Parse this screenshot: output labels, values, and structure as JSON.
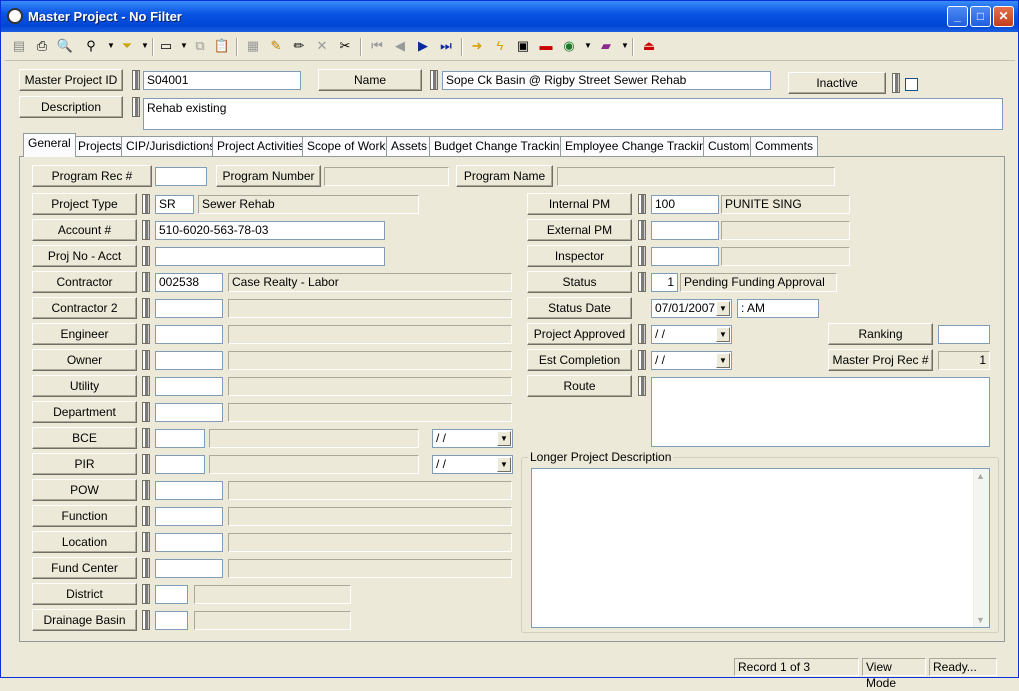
{
  "window": {
    "title": "Master Project - No Filter",
    "minimize": "_",
    "maximize": "□",
    "close": "✕"
  },
  "toolbar": {
    "icons": [
      "save-icon",
      "print-icon",
      "print-preview-icon",
      "binoculars-icon",
      "filter-icon",
      "new-record-icon",
      "copy-icon",
      "paste-icon",
      "undo-icon",
      "edit-icon",
      "delete-icon",
      "cut-icon",
      "first-record-icon",
      "prev-record-icon",
      "next-record-icon",
      "last-record-icon",
      "arrow-icon",
      "lightning-icon",
      "report-icon",
      "toolbox-icon",
      "globe-icon",
      "book-icon",
      "exit-icon"
    ]
  },
  "header": {
    "master_project_id_label": "Master Project ID",
    "master_project_id_value": "S04001",
    "name_label": "Name",
    "name_value": "Sope Ck Basin @ Rigby Street Sewer Rehab",
    "inactive_label": "Inactive",
    "description_label": "Description",
    "description_value": "Rehab existing"
  },
  "tabs": [
    "General",
    "Projects",
    "CIP/Jurisdictions",
    "Project Activities",
    "Scope of Work",
    "Assets",
    "Budget Change Tracking",
    "Employee Change Tracking",
    "Custom",
    "Comments"
  ],
  "general": {
    "program_rec_label": "Program Rec #",
    "program_number_label": "Program Number",
    "program_name_label": "Program Name",
    "project_type_label": "Project Type",
    "project_type_code": "SR",
    "project_type_desc": "Sewer Rehab",
    "account_label": "Account #",
    "account_value": "510-6020-563-78-03",
    "proj_no_acct_label": "Proj No - Acct",
    "contractor_label": "Contractor",
    "contractor_code": "002538",
    "contractor_desc": "Case Realty - Labor",
    "contractor2_label": "Contractor 2",
    "engineer_label": "Engineer",
    "owner_label": "Owner",
    "utility_label": "Utility",
    "department_label": "Department",
    "bce_label": "BCE",
    "bce_date": " / /",
    "pir_label": "PIR",
    "pir_date": " / /",
    "pow_label": "POW",
    "function_label": "Function",
    "location_label": "Location",
    "fund_center_label": "Fund Center",
    "district_label": "District",
    "drainage_basin_label": "Drainage Basin",
    "internal_pm_label": "Internal PM",
    "internal_pm_code": "100",
    "internal_pm_name": "PUNITE SING",
    "external_pm_label": "External PM",
    "inspector_label": "Inspector",
    "status_label": "Status",
    "status_code": "1",
    "status_desc": "Pending Funding Approval",
    "status_date_label": "Status Date",
    "status_date_value": "07/01/2007",
    "status_time_value": " :  AM",
    "project_approved_label": "Project Approved",
    "project_approved_value": " / /",
    "ranking_label": "Ranking",
    "est_completion_label": "Est Completion Date",
    "est_completion_value": " / /",
    "master_proj_rec_label": "Master Proj Rec #",
    "master_proj_rec_value": "1",
    "route_label": "Route",
    "longer_desc_label": "Longer Project Description"
  },
  "statusbar": {
    "record": "Record 1 of 3",
    "mode": "View Mode",
    "state": "Ready..."
  }
}
